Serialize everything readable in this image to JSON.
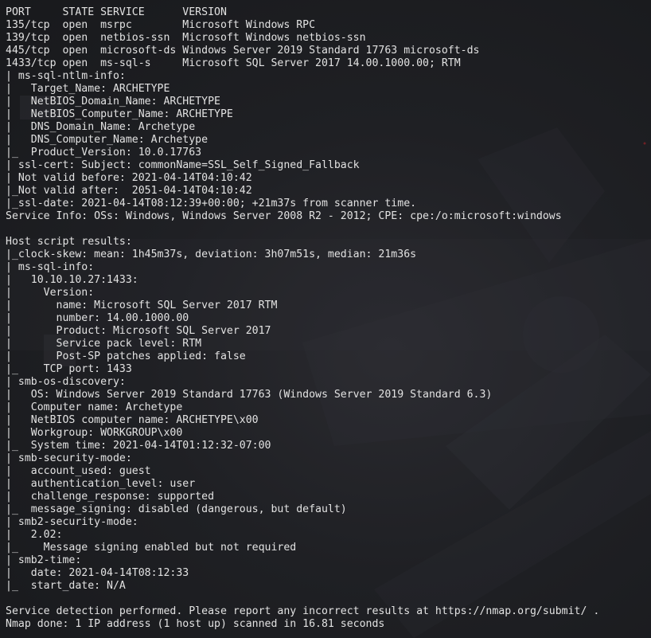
{
  "terminal": {
    "lines": [
      "PORT     STATE SERVICE      VERSION",
      "135/tcp  open  msrpc        Microsoft Windows RPC",
      "139/tcp  open  netbios-ssn  Microsoft Windows netbios-ssn",
      "445/tcp  open  microsoft-ds Windows Server 2019 Standard 17763 microsoft-ds",
      "1433/tcp open  ms-sql-s     Microsoft SQL Server 2017 14.00.1000.00; RTM",
      "| ms-sql-ntlm-info:",
      "|   Target_Name: ARCHETYPE",
      "|   NetBIOS_Domain_Name: ARCHETYPE",
      "|   NetBIOS_Computer_Name: ARCHETYPE",
      "|   DNS_Domain_Name: Archetype",
      "|   DNS_Computer_Name: Archetype",
      "|_  Product_Version: 10.0.17763",
      "| ssl-cert: Subject: commonName=SSL_Self_Signed_Fallback",
      "| Not valid before: 2021-04-14T04:10:42",
      "|_Not valid after:  2051-04-14T04:10:42",
      "|_ssl-date: 2021-04-14T08:12:39+00:00; +21m37s from scanner time.",
      "Service Info: OSs: Windows, Windows Server 2008 R2 - 2012; CPE: cpe:/o:microsoft:windows",
      "",
      "Host script results:",
      "|_clock-skew: mean: 1h45m37s, deviation: 3h07m51s, median: 21m36s",
      "| ms-sql-info:",
      "|   10.10.10.27:1433:",
      "|     Version:",
      "|       name: Microsoft SQL Server 2017 RTM",
      "|       number: 14.00.1000.00",
      "|       Product: Microsoft SQL Server 2017",
      "|       Service pack level: RTM",
      "|       Post-SP patches applied: false",
      "|_    TCP port: 1433",
      "| smb-os-discovery:",
      "|   OS: Windows Server 2019 Standard 17763 (Windows Server 2019 Standard 6.3)",
      "|   Computer name: Archetype",
      "|   NetBIOS computer name: ARCHETYPE\\x00",
      "|   Workgroup: WORKGROUP\\x00",
      "|_  System time: 2021-04-14T01:12:32-07:00",
      "| smb-security-mode:",
      "|   account_used: guest",
      "|   authentication_level: user",
      "|   challenge_response: supported",
      "|_  message_signing: disabled (dangerous, but default)",
      "| smb2-security-mode:",
      "|   2.02:",
      "|_    Message signing enabled but not required",
      "| smb2-time:",
      "|   date: 2021-04-14T08:12:33",
      "|_  start_date: N/A",
      "",
      "Service detection performed. Please report any incorrect results at https://nmap.org/submit/ .",
      "Nmap done: 1 IP address (1 host up) scanned in 16.81 seconds"
    ]
  },
  "colors": {
    "text": "#e2e2e2",
    "background": "#1b1c20"
  }
}
